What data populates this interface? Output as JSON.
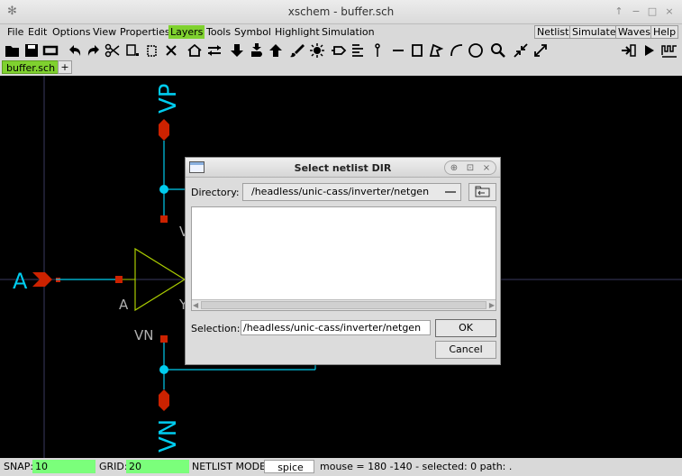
{
  "window": {
    "title": "xschem - buffer.sch",
    "controls": [
      "↑",
      "−",
      "□",
      "×"
    ]
  },
  "menu": {
    "left": [
      "File",
      "Edit",
      "Options",
      "View",
      "Properties",
      "Layers",
      "Tools",
      "Symbol",
      "Highlight",
      "Simulation"
    ],
    "active": "Layers",
    "right": [
      "Netlist",
      "Simulate",
      "Waves",
      "Help"
    ]
  },
  "toolbar": {
    "icons": [
      "open-icon",
      "save-icon",
      "reload-icon",
      "undo-icon",
      "redo-icon",
      "cut-icon",
      "copy-icon",
      "paste-icon",
      "delete-icon",
      "place-symbol-icon",
      "bus-wire-icon",
      "push-down-icon",
      "descend-icon",
      "push-up-icon",
      "brush-icon",
      "sun-icon",
      "pin-icon",
      "netlabel-icon",
      "probe-icon",
      "line-icon",
      "rect-icon",
      "polygon-icon",
      "arc-icon",
      "circle-icon",
      "zoom-icon",
      "shrink-icon",
      "expand-icon"
    ],
    "right_icons": [
      "netlist-icon",
      "simulate-icon",
      "waves-icon"
    ]
  },
  "tabs": {
    "active": "buffer.sch",
    "add": "+"
  },
  "schematic": {
    "labels": {
      "vp_top": "VP",
      "vn_bottom": "VN",
      "input_pin": "A",
      "buffer_a": "A",
      "buffer_vn": "VN",
      "buffer_v_partial": "V",
      "buffer_y_partial": "Y"
    },
    "colors": {
      "wire": "#00ccee",
      "pin": "#cc2200",
      "label": "#00ccee",
      "gate": "#aacc00",
      "grid_axis": "#3a3a60",
      "text": "#b0b0b0"
    }
  },
  "dialog": {
    "title": "Select netlist DIR",
    "directory_label": "Directory:",
    "directory_value": "/headless/unic-cass/inverter/netgen",
    "selection_label": "Selection:",
    "selection_value": "/headless/unic-cass/inverter/netgen",
    "ok_label": "OK",
    "cancel_label": "Cancel",
    "controls": [
      "⊕",
      "⊡",
      "×"
    ]
  },
  "status": {
    "snap_label": "SNAP:",
    "snap_value": "10",
    "grid_label": "GRID:",
    "grid_value": "20",
    "netlist_mode_label": "NETLIST MODE:",
    "netlist_mode_value": "spice",
    "mouse_info": "mouse = 180 -140 - selected: 0 path: ."
  }
}
